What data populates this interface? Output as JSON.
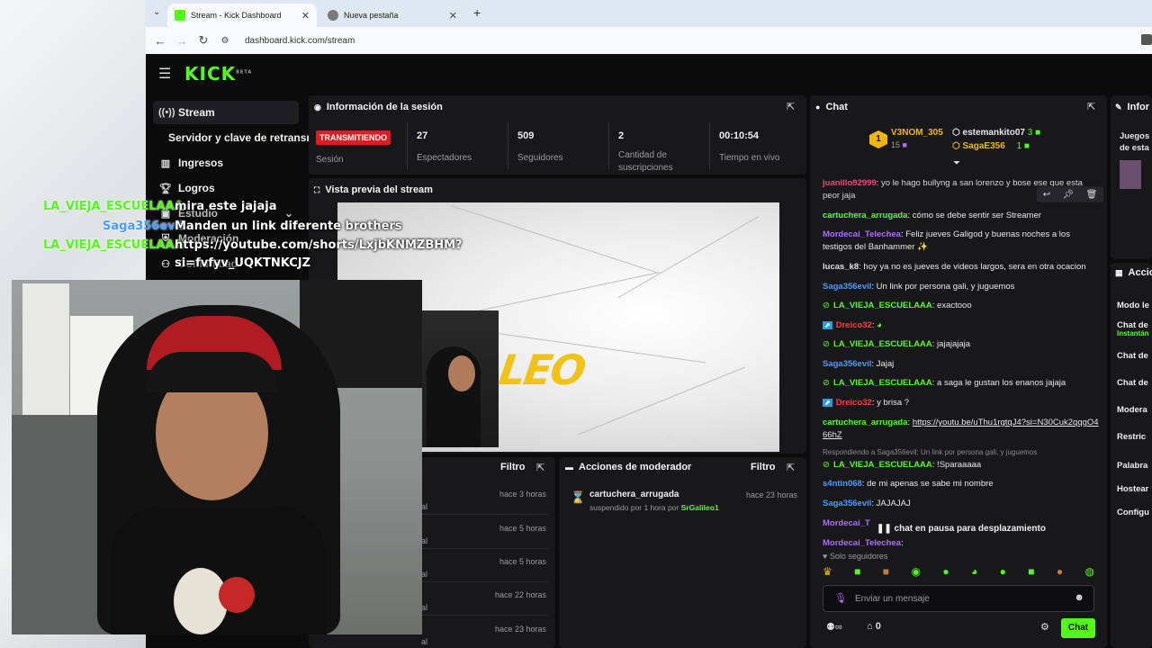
{
  "browser": {
    "tab1": "Stream - Kick Dashboard",
    "tab2": "Nueva pestaña",
    "url": "dashboard.kick.com/stream"
  },
  "brand": {
    "logo": "KICK",
    "beta": "BETA",
    "accent": "#53fc18"
  },
  "sidebar": [
    {
      "label": "Stream",
      "icon": "broadcast-icon"
    },
    {
      "label": "Servidor y clave de retransm"
    },
    {
      "label": "Ingresos",
      "icon": "chart-icon"
    },
    {
      "label": "Logros",
      "icon": "trophy-icon"
    },
    {
      "label": "Estudio",
      "icon": "studio-icon"
    },
    {
      "label": "Moderación",
      "icon": "shield-icon"
    },
    {
      "label": "Comunidad",
      "icon": "community-icon"
    }
  ],
  "session": {
    "title": "Información de la sesión",
    "status": "TRANSMITIENDO",
    "status_label": "Sesión",
    "stats": [
      {
        "value": "27",
        "label": "Espectadores"
      },
      {
        "value": "509",
        "label": "Seguidores"
      },
      {
        "value": "2",
        "label": "Cantidad de suscripciones"
      },
      {
        "value": "00:10:54",
        "label": "Tiempo en vivo"
      }
    ]
  },
  "preview": {
    "title": "Vista previa del stream",
    "overlay_text": "LEO"
  },
  "activity": {
    "filter": "Filtro",
    "rows": [
      {
        "time": "hace 3 horas",
        "frag": "al"
      },
      {
        "time": "hace 5 horas",
        "frag": "al"
      },
      {
        "time": "hace 5 horas",
        "frag": "al"
      },
      {
        "time": "hace 22 horas",
        "frag": "al"
      },
      {
        "time": "hace 23 horas",
        "frag": "al"
      }
    ]
  },
  "mod_actions": {
    "title": "Acciones de moderador",
    "filter": "Filtro",
    "entry": {
      "user": "cartuchera_arrugada",
      "time": "hace 23 horas",
      "detail": "suspendido por 1 hora por",
      "by": "SrGalileo1"
    }
  },
  "chat": {
    "title": "Chat",
    "top": [
      {
        "rank": "1",
        "name": "V3NOM_305",
        "count": "15"
      },
      {
        "name": "estemankito07",
        "count": "3"
      },
      {
        "name": "SagaE356",
        "count": "1"
      }
    ],
    "messages": [
      {
        "user": "juanillo92999",
        "color": "#ff4d8d",
        "text": ": yo le hago bullyng a san lorenzo y bose ese que esta peor jaja"
      },
      {
        "user": "cartuchera_arrugada",
        "color": "#53fc18",
        "text": ": cómo se debe sentir ser Streamer"
      },
      {
        "user": "Mordecai_Telechea",
        "color": "#b06cff",
        "text": ": Feliz jueves Galigod y buenas noches a los testigos del Banhammer ✨"
      },
      {
        "user": "lucas_k8",
        "color": "#e0e0e0",
        "text": ": hoy ya no es jueves de videos largos, sera en otra ocacion"
      },
      {
        "user": "Saga356evil",
        "color": "#4a9bff",
        "text": ": Un link por persona gali, y juguemos"
      },
      {
        "user": "LA_VIEJA_ESCUELAAA",
        "color": "#53fc18",
        "text": ": exactooo"
      },
      {
        "user": "Dreico32",
        "color": "#ff3b3b",
        "text": ":"
      },
      {
        "user": "LA_VIEJA_ESCUELAAA",
        "color": "#53fc18",
        "text": ": jajajajaja"
      },
      {
        "user": "Saga356evil",
        "color": "#4a9bff",
        "text": ": Jajaj"
      },
      {
        "user": "LA_VIEJA_ESCUELAAA",
        "color": "#53fc18",
        "text": ": a saga le gustan los enanos jajaja"
      },
      {
        "user": "Dreico32",
        "color": "#ff3b3b",
        "text": ": y brisa ?"
      },
      {
        "user": "cartuchera_arrugada",
        "color": "#53fc18",
        "text": ": ",
        "link": "https://youtu.be/uThu1rgtqJ4?si=N30Cuk2qqgO466hZ"
      },
      {
        "reply": "Respondiendo a Saga356evil: Un link por persona gali, y juguemos",
        "user": "LA_VIEJA_ESCUELAAA",
        "color": "#53fc18",
        "text": ": !Sparaaaaa"
      },
      {
        "user": "s4ntin068",
        "color": "#4a9bff",
        "text": ": de mi apenas se sabe mi nombre"
      },
      {
        "user": "Saga356evil",
        "color": "#4a9bff",
        "text": ": JAJAJAJ"
      },
      {
        "user": "Mordecai_T",
        "color": "#b06cff",
        "text": ""
      },
      {
        "user": "Mordecai_Telechea",
        "color": "#b06cff",
        "text": ":"
      }
    ],
    "paused": "chat en pausa para desplazamiento",
    "mode": "Solo seguidores",
    "input_placeholder": "Enviar un mensaje",
    "viewer_count": "0",
    "send": "Chat"
  },
  "right_panel": {
    "info_title": "Infor",
    "info_game": [
      "Juegos",
      "de esta"
    ],
    "actions_title": "Accio",
    "actions": [
      "Modo le",
      "Chat de",
      "Instantán",
      "Chat de",
      "Chat de",
      "Modera",
      "Restric",
      "Palabra",
      "Hostear",
      "Configu"
    ]
  },
  "overlay_chat": [
    {
      "user": "LA_VIEJA_ESCUELAAA",
      "msg": "mira este jajaja"
    },
    {
      "user": "Saga356evil",
      "msg": "Manden un link diferente brothers"
    },
    {
      "user": "LA_VIEJA_ESCUELAAA",
      "msg": "https://youtube.com/shorts/LxjbKNMZBHM?"
    },
    {
      "user": "",
      "msg": "si=fvfyv_UQKTNKCJZ"
    }
  ]
}
